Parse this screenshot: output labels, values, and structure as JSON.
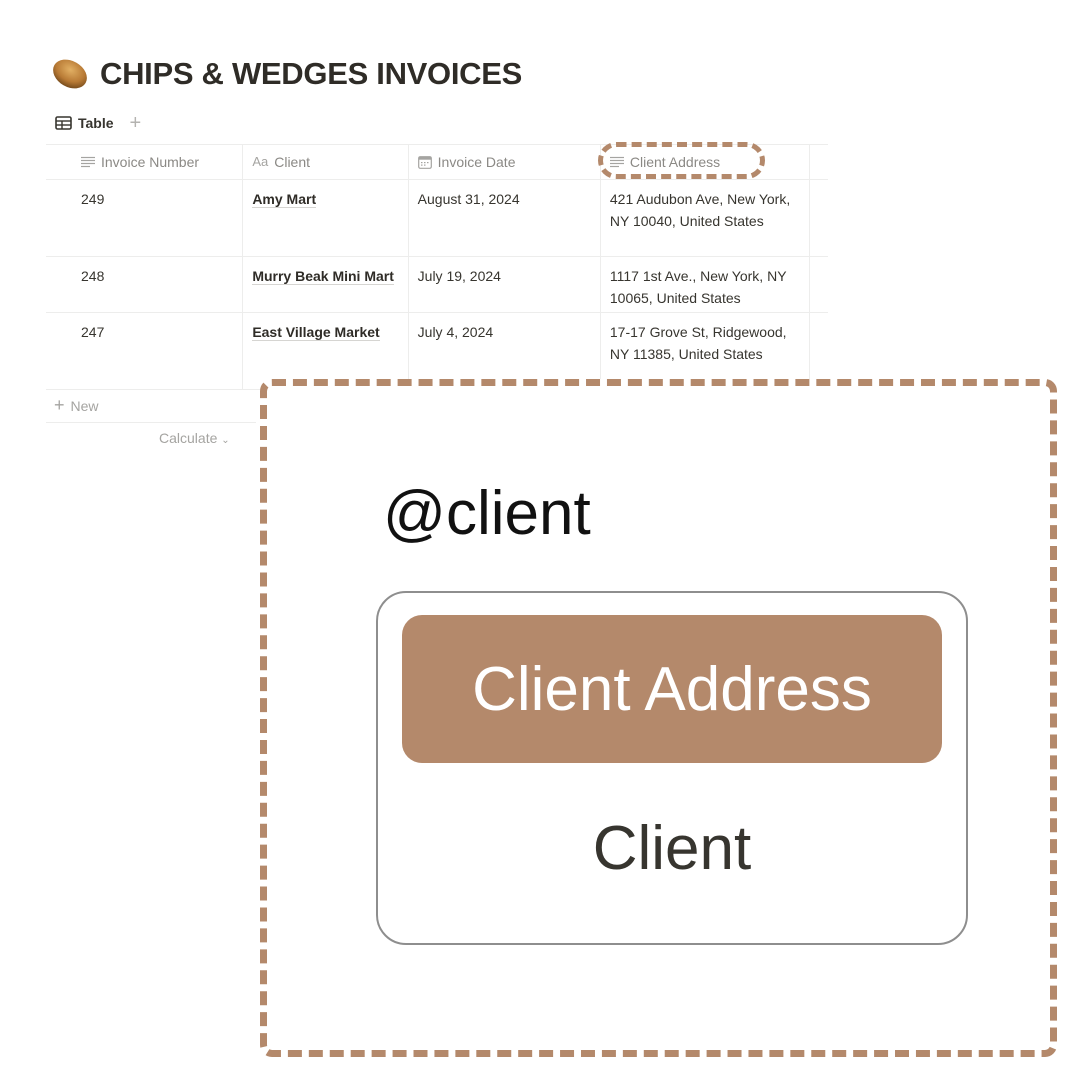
{
  "page": {
    "icon": "potato-icon",
    "title": "CHIPS & WEDGES INVOICES"
  },
  "views": {
    "active_tab": {
      "label": "Table",
      "icon": "table-icon"
    },
    "add_icon": "+"
  },
  "table": {
    "columns": [
      {
        "label": "Invoice Number",
        "icon": "text-lines-icon"
      },
      {
        "label": "Client",
        "icon": "title-aa-icon",
        "icon_text": "Aa"
      },
      {
        "label": "Invoice Date",
        "icon": "calendar-icon"
      },
      {
        "label": "Client Address",
        "icon": "text-lines-icon"
      }
    ],
    "rows": [
      {
        "invoice_number": "249",
        "client": "Amy Mart",
        "invoice_date": "August 31, 2024",
        "client_address": "421 Audubon Ave, New York, NY 10040, United States"
      },
      {
        "invoice_number": "248",
        "client": "Murry Beak Mini Mart",
        "invoice_date": "July 19, 2024",
        "client_address": "1117 1st Ave., New York, NY 10065, United States"
      },
      {
        "invoice_number": "247",
        "client": "East Village Market",
        "invoice_date": "July 4, 2024",
        "client_address": "17-17 Grove St, Ridgewood, NY 11385, United States"
      }
    ],
    "new_row_label": "New",
    "calculate_label": "Calculate"
  },
  "callout": {
    "typed_text": "@client",
    "options": [
      {
        "label": "Client Address",
        "selected": true
      },
      {
        "label": "Client",
        "selected": false
      }
    ]
  },
  "colors": {
    "accent": "#b4896b",
    "text": "#37352f",
    "muted": "#8b8985"
  }
}
